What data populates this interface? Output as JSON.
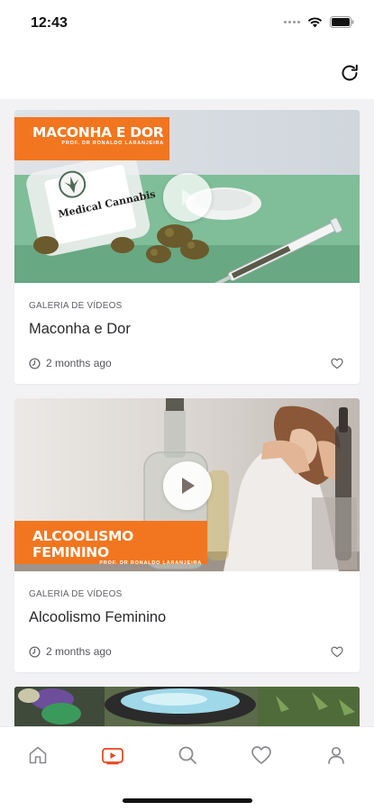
{
  "status_bar": {
    "time": "12:43"
  },
  "colors": {
    "accent": "#f27620",
    "active_tab": "#e8441a",
    "icon": "#8a8a90"
  },
  "videos": [
    {
      "banner_title": "MACONHA E DOR",
      "banner_subtitle": "PROF. DR RONALDO LARANJEIRA",
      "jar_label": "Medical Cannabis",
      "category": "GALERIA DE VÍDEOS",
      "title": "Maconha e Dor",
      "time_ago": "2 months ago"
    },
    {
      "banner_title": "ALCOOLISMO FEMININO",
      "banner_subtitle": "PROF. DR RONALDO LARANJEIRA",
      "category": "GALERIA DE VÍDEOS",
      "title": "Alcoolismo Feminino",
      "time_ago": "2 months ago"
    }
  ],
  "tab_bar": {
    "items": [
      "home-icon",
      "video-icon",
      "search-icon",
      "heart-icon",
      "user-icon"
    ],
    "active": "video-icon"
  }
}
